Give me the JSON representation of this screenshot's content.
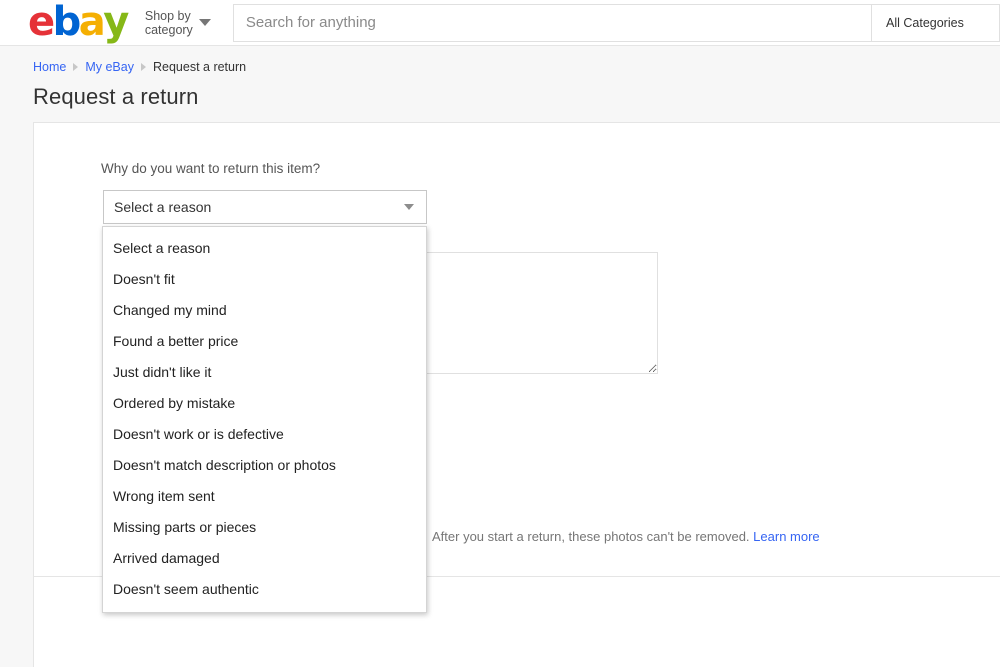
{
  "header": {
    "logo": {
      "letters": [
        {
          "char": "e",
          "color": "#e53238"
        },
        {
          "char": "b",
          "color": "#0064d2"
        },
        {
          "char": "a",
          "color": "#f5af02"
        },
        {
          "char": "y",
          "color": "#86b817"
        }
      ],
      "alt": "ebay"
    },
    "shop_by_category_line1": "Shop by",
    "shop_by_category_line2": "category",
    "search_placeholder": "Search for anything",
    "search_value": "",
    "all_categories_label": "All Categories"
  },
  "breadcrumb": {
    "items": [
      {
        "label": "Home",
        "link": true
      },
      {
        "label": "My eBay",
        "link": true
      },
      {
        "label": "Request a return",
        "link": false
      }
    ]
  },
  "page": {
    "title": "Request a return"
  },
  "form": {
    "reason_label": "Why do you want to return this item?",
    "reason_selected": "Select a reason",
    "comment_value": "",
    "photos_note_text": "After you start a return, these photos can't be removed.",
    "photos_note_link": "Learn more"
  },
  "dropdown": {
    "open": true,
    "options": [
      "Select a reason",
      "Doesn't fit",
      "Changed my mind",
      "Found a better price",
      "Just didn't like it",
      "Ordered by mistake",
      "Doesn't work or is defective",
      "Doesn't match description or photos",
      "Wrong item sent",
      "Missing parts or pieces",
      "Arrived damaged",
      "Doesn't seem authentic"
    ]
  },
  "colors": {
    "link": "#3665f3",
    "page_background": "#f7f7f7",
    "card_background": "#ffffff",
    "border": "#e5e5e5"
  }
}
